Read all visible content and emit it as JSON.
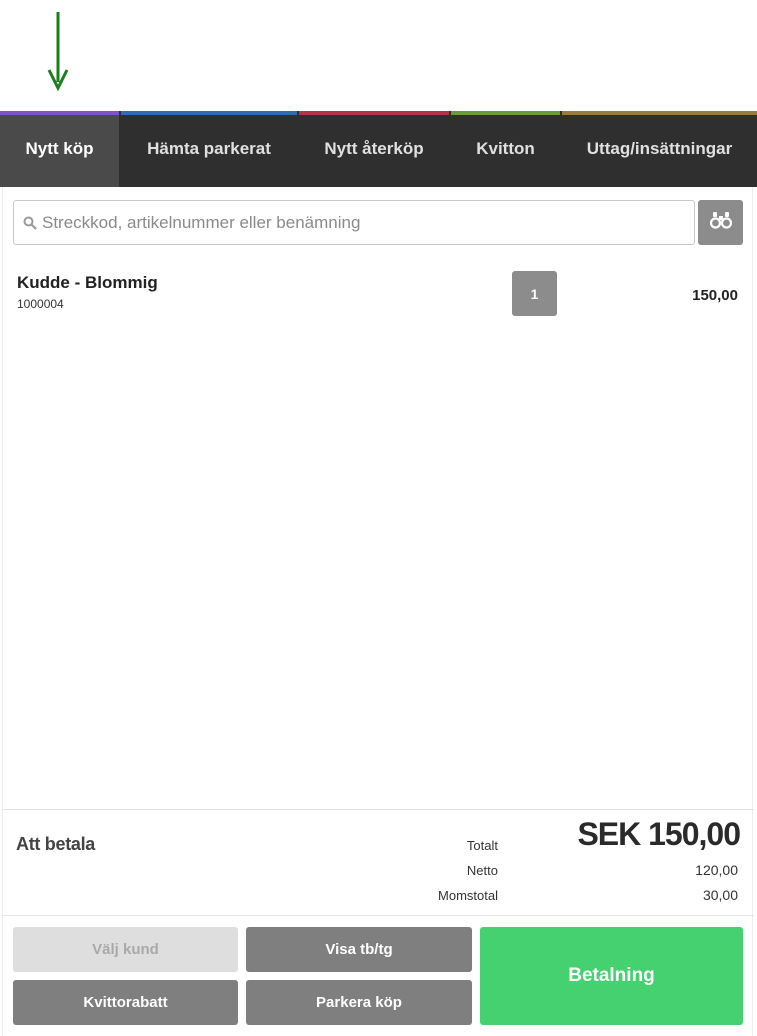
{
  "tabs": [
    {
      "label": "Nytt köp",
      "accent": "#7a55c7",
      "active": true
    },
    {
      "label": "Hämta parkerat",
      "accent": "#2f6cb3",
      "active": false
    },
    {
      "label": "Nytt återköp",
      "accent": "#b0344a",
      "active": false
    },
    {
      "label": "Kvitton",
      "accent": "#6c9a3a",
      "active": false
    },
    {
      "label": "Uttag/insättningar",
      "accent": "#9b7a3e",
      "active": false
    }
  ],
  "search": {
    "placeholder": "Streckkod, artikelnummer eller benämning",
    "value": "",
    "search_icon": "search-icon",
    "lookup_icon": "binoculars-icon"
  },
  "cart": {
    "items": [
      {
        "name": "Kudde - Blommig",
        "article_number": "1000004",
        "quantity": "1",
        "price": "150,00"
      }
    ]
  },
  "summary": {
    "pay_label": "Att betala",
    "total_label": "Totalt",
    "total_value": "SEK 150,00",
    "net_label": "Netto",
    "net_value": "120,00",
    "vat_label": "Momstotal",
    "vat_value": "30,00"
  },
  "actions": {
    "choose_customer": "Välj kund",
    "show_margin": "Visa tb/tg",
    "receipt_discount": "Kvittorabatt",
    "park_purchase": "Parkera köp",
    "payment": "Betalning"
  },
  "colors": {
    "annotation_arrow": "#1a7f1a",
    "payment_green": "#45d16f",
    "tabbar_bg": "#2f2f2f"
  }
}
